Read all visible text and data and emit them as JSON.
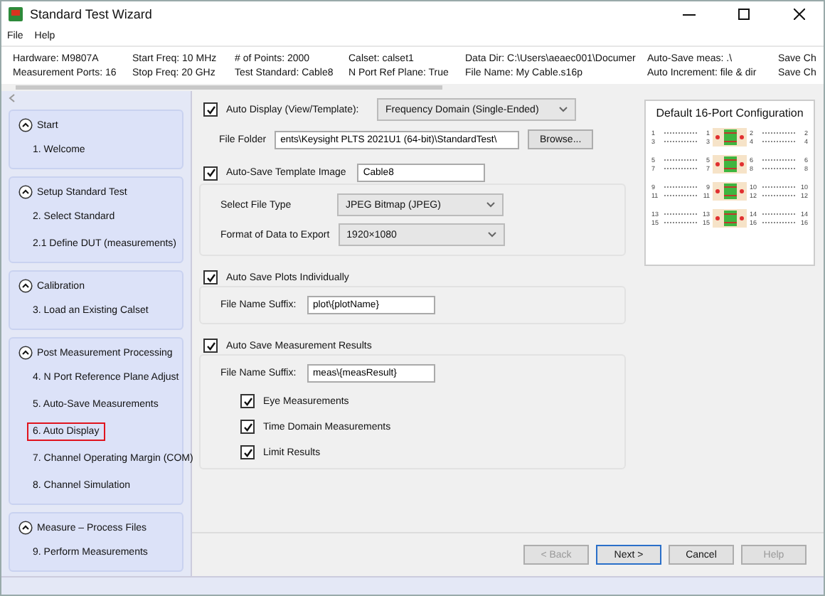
{
  "window": {
    "title": "Standard Test Wizard"
  },
  "menu": [
    {
      "label": "File"
    },
    {
      "label": "Help"
    }
  ],
  "info": [
    [
      "Hardware: M9807A",
      "Measurement Ports: 16"
    ],
    [
      "Start Freq: 10 MHz",
      "Stop Freq: 20 GHz"
    ],
    [
      "# of Points: 2000",
      "Test Standard: Cable8"
    ],
    [
      "Calset: calset1",
      "N Port Ref Plane: True"
    ],
    [
      "Data Dir: C:\\Users\\aeaec001\\Documer",
      "File Name: My Cable.s16p"
    ],
    [
      "Auto-Save meas: .\\",
      "Auto Increment: file & dir"
    ],
    [
      "Save Ch",
      "Save Ch"
    ]
  ],
  "sidebar": [
    {
      "title": "Start",
      "expanded": true,
      "items": [
        {
          "label": "1. Welcome",
          "selected": false
        }
      ]
    },
    {
      "title": "Setup Standard Test",
      "expanded": true,
      "items": [
        {
          "label": "2. Select Standard",
          "selected": false
        },
        {
          "label": "2.1 Define DUT   (measurements)",
          "selected": false
        }
      ]
    },
    {
      "title": "Calibration",
      "expanded": true,
      "items": [
        {
          "label": "3. Load an Existing Calset",
          "selected": false
        }
      ]
    },
    {
      "title": "Post Measurement Processing",
      "expanded": true,
      "items": [
        {
          "label": "4. N Port Reference Plane Adjust",
          "selected": false
        },
        {
          "label": "5. Auto-Save Measurements",
          "selected": false
        },
        {
          "label": "6. Auto Display",
          "selected": true
        },
        {
          "label": "7. Channel Operating Margin (COM)",
          "selected": false
        },
        {
          "label": "8. Channel Simulation",
          "selected": false
        }
      ]
    },
    {
      "title": "Measure – Process Files",
      "expanded": true,
      "items": [
        {
          "label": "9. Perform Measurements",
          "selected": false
        }
      ]
    }
  ],
  "display": {
    "label": "Auto Display (View/Template):",
    "checked": true,
    "view": "Frequency Domain (Single-Ended)",
    "folder_label": "File Folder",
    "folder": "ents\\Keysight PLTS 2021U1 (64-bit)\\StandardTest\\",
    "browse": "Browse..."
  },
  "groups": [
    {
      "label": "Auto-Save Template Image",
      "checked": true,
      "value": "Cable8",
      "fields": [
        {
          "kind": "select",
          "label": "Select File Type",
          "value": "JPEG Bitmap (JPEG)"
        },
        {
          "kind": "select",
          "label": "Format of Data to Export",
          "value": "1920×1080"
        }
      ]
    },
    {
      "label": "Auto Save Plots Individually",
      "checked": true,
      "fields": [
        {
          "kind": "text",
          "label": "File Name Suffix:",
          "value": "plot\\{plotName}"
        }
      ]
    },
    {
      "label": "Auto Save Measurement Results",
      "checked": true,
      "fields": [
        {
          "kind": "text",
          "label": "File Name Suffix:",
          "value": "meas\\{measResult}"
        }
      ],
      "options": [
        {
          "label": "Eye Measurements",
          "checked": true
        },
        {
          "label": "Time Domain Measurements",
          "checked": true
        },
        {
          "label": "Limit Results",
          "checked": true
        }
      ]
    }
  ],
  "config": {
    "title": "Default 16-Port Configuration",
    "groups": [
      {
        "rows": [
          [
            "1",
            "1",
            "2",
            "2"
          ],
          [
            "3",
            "3",
            "4",
            "4"
          ]
        ]
      },
      {
        "rows": [
          [
            "5",
            "5",
            "6",
            "6"
          ],
          [
            "7",
            "7",
            "8",
            "8"
          ]
        ]
      },
      {
        "rows": [
          [
            "9",
            "9",
            "10",
            "10"
          ],
          [
            "11",
            "11",
            "12",
            "12"
          ]
        ]
      },
      {
        "rows": [
          [
            "13",
            "13",
            "14",
            "14"
          ],
          [
            "15",
            "15",
            "16",
            "16"
          ]
        ]
      }
    ]
  },
  "buttons": [
    {
      "label": "< Back",
      "disabled": true,
      "default": false
    },
    {
      "label": "Next >",
      "disabled": false,
      "default": true
    },
    {
      "label": "Cancel",
      "disabled": false,
      "default": false
    },
    {
      "label": "Help",
      "disabled": true,
      "default": false
    }
  ]
}
